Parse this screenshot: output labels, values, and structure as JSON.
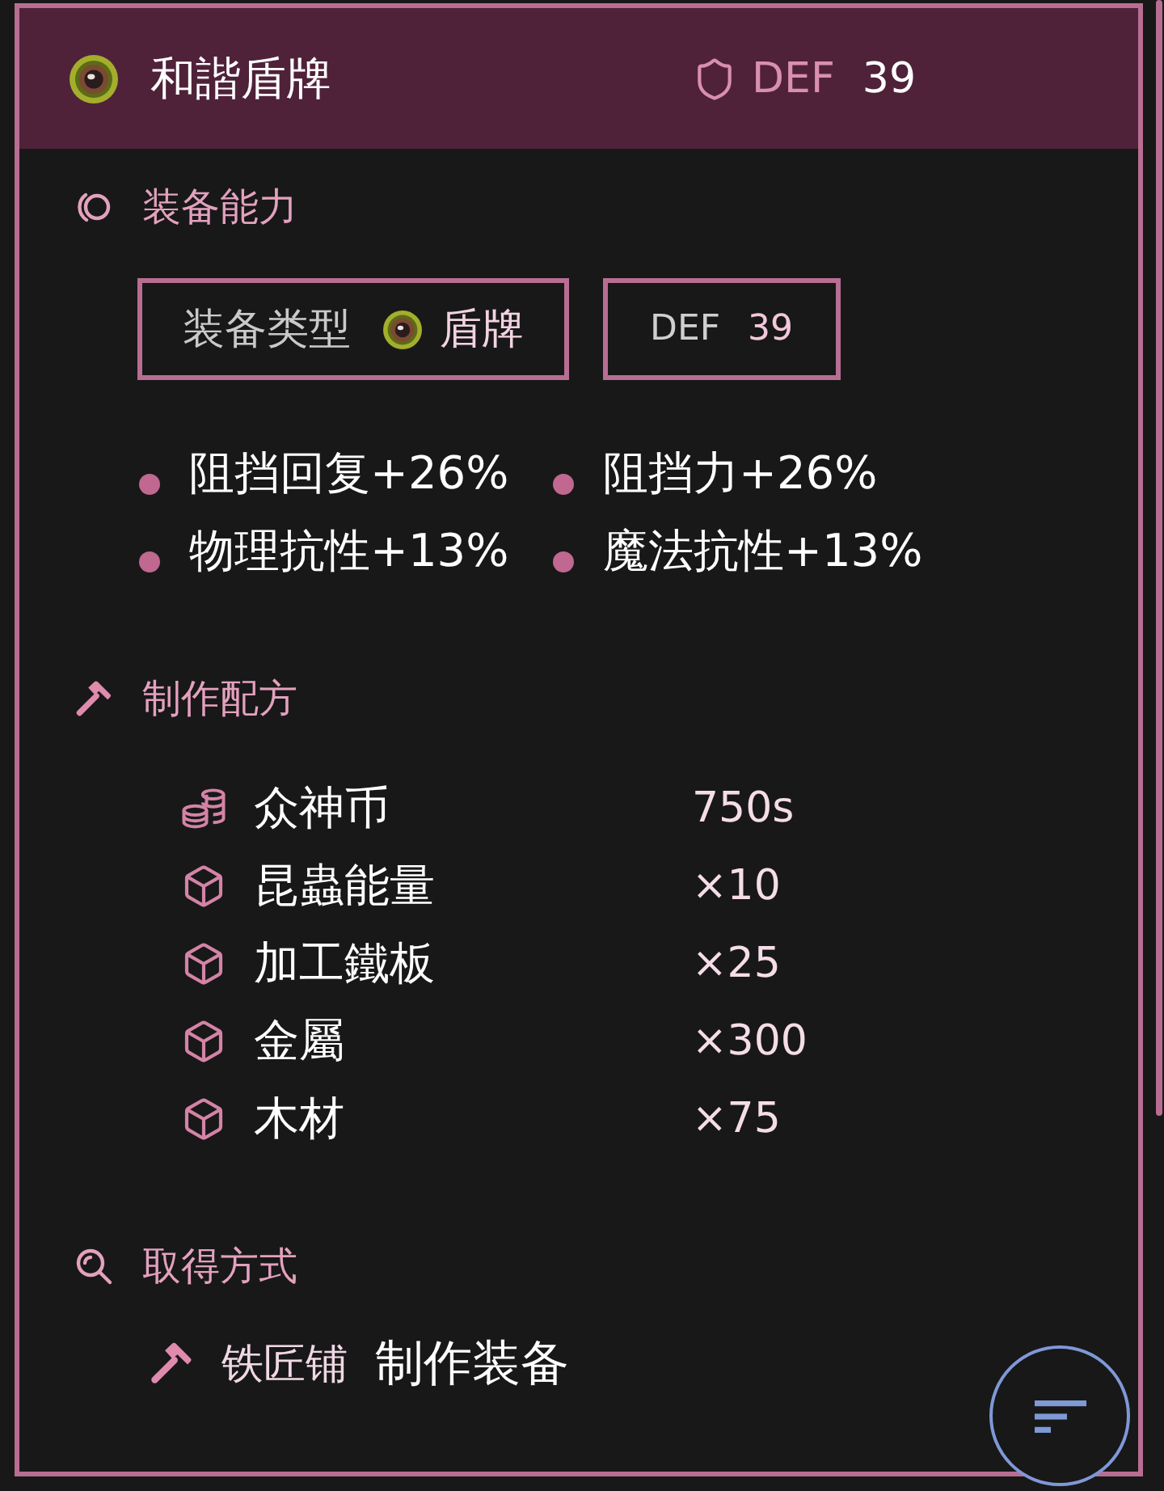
{
  "header": {
    "title": "和諧盾牌",
    "stat_label": "DEF",
    "stat_value": "39"
  },
  "abilities": {
    "title": "装备能力",
    "type_label": "装备类型",
    "type_value": "盾牌",
    "stat_label": "DEF",
    "stat_value": "39",
    "bonuses": [
      "阻挡回复+26%",
      "阻挡力+26%",
      "物理抗性+13%",
      "魔法抗性+13%"
    ]
  },
  "recipe": {
    "title": "制作配方",
    "items": [
      {
        "kind": "coin",
        "name": "众神币",
        "amount": "750s"
      },
      {
        "kind": "material",
        "name": "昆蟲能量",
        "amount": "×10"
      },
      {
        "kind": "material",
        "name": "加工鐵板",
        "amount": "×25"
      },
      {
        "kind": "material",
        "name": "金屬",
        "amount": "×300"
      },
      {
        "kind": "material",
        "name": "木材",
        "amount": "×75"
      }
    ]
  },
  "acquisition": {
    "title": "取得方式",
    "sources": [
      {
        "place": "铁匠铺",
        "method": "制作装备"
      }
    ]
  }
}
